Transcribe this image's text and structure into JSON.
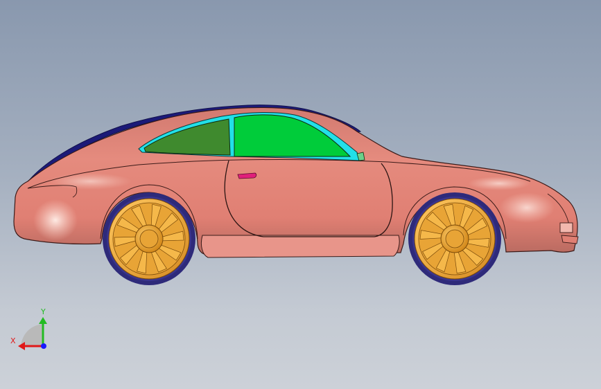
{
  "viewport": {
    "background_top": "#8998ae",
    "background_bottom": "#ccd1d8"
  },
  "model": {
    "body_color": "#e58b7e",
    "body_shadow": "#b86a60",
    "body_highlight": "#fbd4c8",
    "rear_glass_color": "#3f8a2e",
    "front_glass_color": "#00cc3a",
    "glass_trim_color": "#22e0e8",
    "roof_edge_color": "#1c1a78",
    "handle_color": "#e0207a",
    "wheel_color": "#e8a436",
    "tire_color": "#2e2a7a"
  },
  "triad": {
    "x_label": "X",
    "y_label": "Y",
    "x_color": "#e01818",
    "y_color": "#22bb22",
    "z_color": "#1a1aff"
  }
}
